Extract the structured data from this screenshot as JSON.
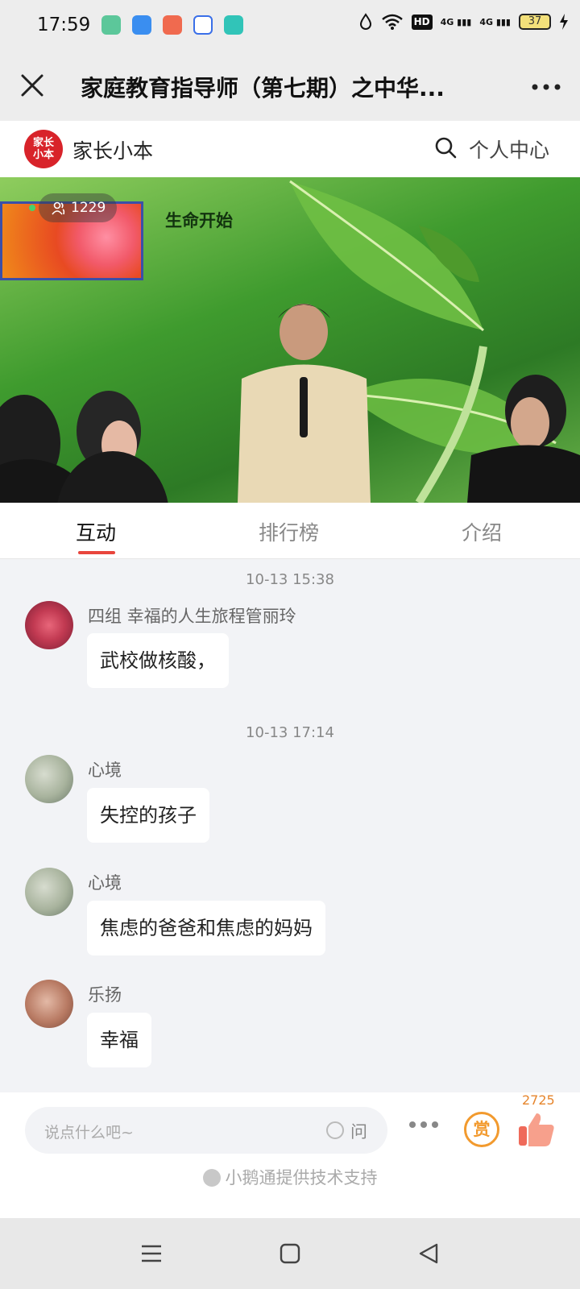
{
  "status_bar": {
    "time": "17:59",
    "network_label": "HD",
    "signal1": "4G",
    "signal2": "4G",
    "battery": "37",
    "icons": [
      "notes-app-icon",
      "browser-app-icon",
      "music-app-icon",
      "baidu-app-icon",
      "chat-app-icon",
      "water-drop-icon",
      "wifi-icon",
      "charging-icon"
    ]
  },
  "title_bar": {
    "title": "家庭教育指导师（第七期）之中华...",
    "close_icon": "close-icon",
    "more_icon": "more-icon"
  },
  "brand": {
    "logo_text": "家长小本",
    "name": "家长小本",
    "personal_center": "个人中心",
    "search_icon": "search-icon"
  },
  "video": {
    "viewer_count": "1229",
    "slide_title": "生命开始"
  },
  "tabs": {
    "items": [
      {
        "label": "互动",
        "active": true
      },
      {
        "label": "排行榜",
        "active": false
      },
      {
        "label": "介绍",
        "active": false
      }
    ]
  },
  "chat": {
    "messages": [
      {
        "timestamp": "10-13 15:38",
        "user": "四组 幸福的人生旅程管丽玲",
        "text": "武校做核酸，",
        "avatar_colors": [
          "#e8667a",
          "#7a1f34"
        ]
      },
      {
        "timestamp": "10-13 17:14",
        "user": "心境",
        "text": "失控的孩子",
        "avatar_colors": [
          "#d7dccf",
          "#6c7a6a"
        ]
      },
      {
        "user": "心境",
        "text": "焦虑的爸爸和焦虑的妈妈",
        "avatar_colors": [
          "#d7dccf",
          "#6c7a6a"
        ]
      },
      {
        "user": "乐扬",
        "text": "幸福",
        "avatar_colors": [
          "#e3b9a6",
          "#7c4a3b"
        ]
      }
    ]
  },
  "input_bar": {
    "placeholder": "说点什么吧~",
    "ask_label": "问",
    "reward_label": "赏",
    "like_count": "2725",
    "powered_by": "小鹅通提供技术支持"
  },
  "colors": {
    "accent_red": "#e8453c",
    "reward_orange": "#f29a2e",
    "like_orange": "#e6852c",
    "brand_red": "#d8232a"
  }
}
